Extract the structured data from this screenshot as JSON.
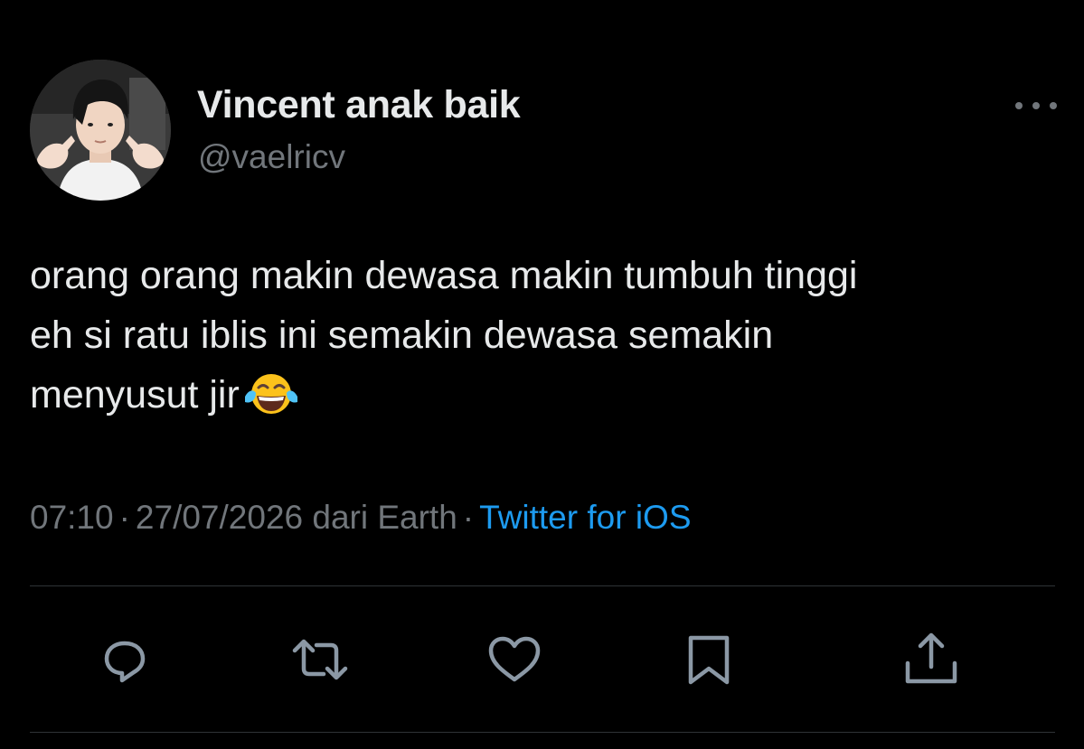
{
  "tweet": {
    "display_name": "Vincent anak baik",
    "handle": "@vaelricv",
    "text_lines": [
      "orang orang makin dewasa makin tumbuh tinggi",
      "eh si ratu iblis ini semakin dewasa semakin",
      "menyusut jir"
    ],
    "emoji": "face-with-tears-of-joy",
    "time": "07:10",
    "separator": "·",
    "date_location": "27/07/2026 dari Earth",
    "source": "Twitter for iOS"
  },
  "actions": [
    {
      "name": "reply",
      "icon": "speech-bubble-icon"
    },
    {
      "name": "retweet",
      "icon": "retweet-icon"
    },
    {
      "name": "like",
      "icon": "heart-icon"
    },
    {
      "name": "bookmark",
      "icon": "bookmark-icon"
    },
    {
      "name": "share",
      "icon": "share-icon"
    }
  ],
  "colors": {
    "background": "#000000",
    "primary_text": "#e7e9ea",
    "secondary_text": "#71767b",
    "link": "#1d9bf0",
    "divider": "#2f3336"
  }
}
